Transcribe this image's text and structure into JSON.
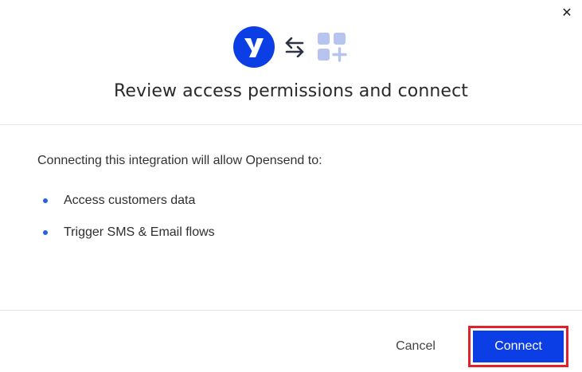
{
  "dialog": {
    "close_icon": "close-icon",
    "title": "Review access permissions and connect"
  },
  "logos": {
    "brand_letter": "Y",
    "brand_icon": "yotpo-logo",
    "swap_icon": "swap-arrows-icon",
    "app_icon": "apps-add-icon",
    "colors": {
      "brand_blue": "#0c3ee6",
      "app_icon": "#b8c4f0"
    }
  },
  "body": {
    "intro": "Connecting this integration will allow Opensend to:",
    "permissions": [
      {
        "label": "Access customers data"
      },
      {
        "label": "Trigger SMS & Email flows"
      }
    ]
  },
  "footer": {
    "cancel_label": "Cancel",
    "connect_label": "Connect",
    "colors": {
      "primary": "#0c3ee6",
      "highlight": "#e0202a"
    }
  }
}
